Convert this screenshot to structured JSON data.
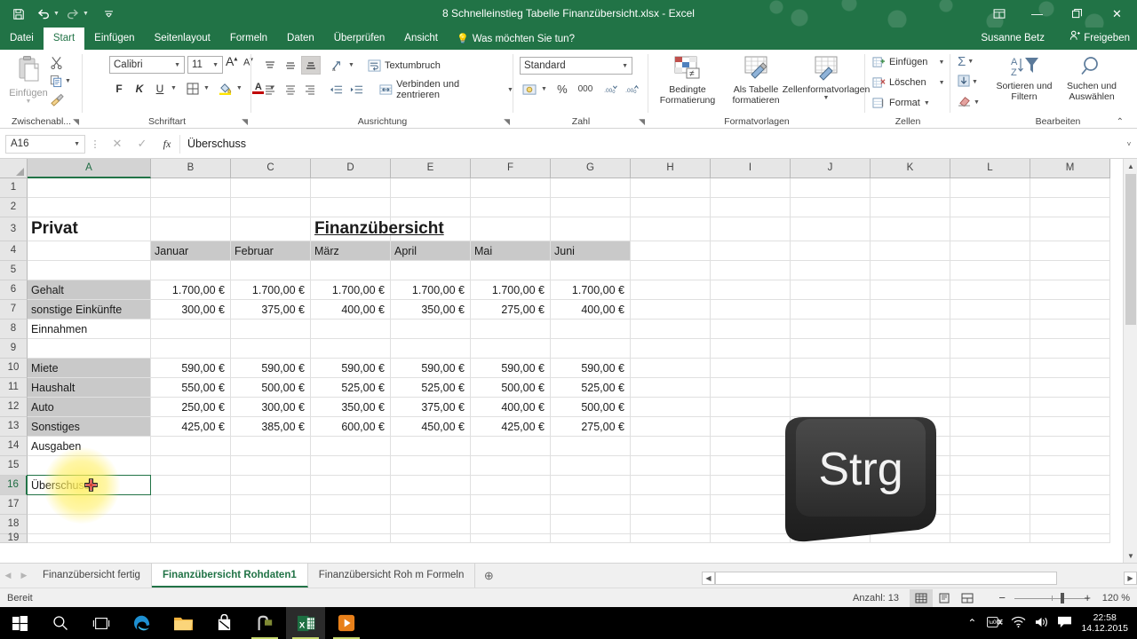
{
  "titlebar": {
    "document_title": "8 Schnelleinstieg Tabelle Finanzübersicht.xlsx - Excel",
    "qat": [
      {
        "name": "save",
        "glyph": "ὋE"
      },
      {
        "name": "undo",
        "glyph": "↶"
      },
      {
        "name": "redo",
        "glyph": "↷"
      },
      {
        "name": "customize",
        "glyph": "▾"
      }
    ],
    "ribbon_display_options": "⬚",
    "minimize": "—",
    "restore": "❐",
    "close": "✕"
  },
  "ribbon_tabs": [
    {
      "label": "Datei",
      "active": false
    },
    {
      "label": "Start",
      "active": true
    },
    {
      "label": "Einfügen",
      "active": false
    },
    {
      "label": "Seitenlayout",
      "active": false
    },
    {
      "label": "Formeln",
      "active": false
    },
    {
      "label": "Daten",
      "active": false
    },
    {
      "label": "Überprüfen",
      "active": false
    },
    {
      "label": "Ansicht",
      "active": false
    }
  ],
  "tell_me": "Was möchten Sie tun?",
  "account_name": "Susanne Betz",
  "share_label": "Freigeben",
  "ribbon": {
    "clipboard": {
      "group_label": "Zwischenabl...",
      "paste_label": "Einfügen",
      "cut": "Ausschneiden",
      "copy": "Kopieren",
      "format_painter": "Format übertragen"
    },
    "font": {
      "group_label": "Schriftart",
      "font_name": "Calibri",
      "font_size": "11",
      "grow_font": "A",
      "shrink_font": "A",
      "bold": "F",
      "italic": "K",
      "underline": "U",
      "borders": "Rahmen",
      "fill_color": "Füllfarbe",
      "font_color": "Schriftfarbe"
    },
    "alignment": {
      "group_label": "Ausrichtung",
      "wrap_text": "Textumbruch",
      "merge_center": "Verbinden und zentrieren"
    },
    "number": {
      "group_label": "Zahl",
      "format": "Standard",
      "percent": "%",
      "thousands": "000",
      "increase_decimal": "·⁰00",
      "decrease_decimal": "→00"
    },
    "styles": {
      "group_label": "Formatvorlagen",
      "conditional_line1": "Bedingte",
      "conditional_line2": "Formatierung",
      "astable_line1": "Als Tabelle",
      "astable_line2": "formatieren",
      "cellstyles": "Zellenformatvorlagen"
    },
    "cells": {
      "group_label": "Zellen",
      "insert": "Einfügen",
      "delete": "Löschen",
      "format": "Format"
    },
    "editing": {
      "group_label": "Bearbeiten",
      "autosum": "Σ",
      "fill": "↓",
      "clear": "⌫",
      "sort_line1": "Sortieren und",
      "sort_line2": "Filtern",
      "find_line1": "Suchen und",
      "find_line2": "Auswählen"
    },
    "collapse_ribbon": "⌃"
  },
  "formula_bar": {
    "name_box": "A16",
    "cancel": "✕",
    "enter": "✓",
    "insert_function": "fx",
    "content": "Überschuss",
    "expand": "˅"
  },
  "grid": {
    "columns": [
      "A",
      "B",
      "C",
      "D",
      "E",
      "F",
      "G",
      "H",
      "I",
      "J",
      "K",
      "L",
      "M"
    ],
    "rows": [
      "1",
      "2",
      "3",
      "4",
      "5",
      "6",
      "7",
      "8",
      "9",
      "10",
      "11",
      "12",
      "13",
      "14",
      "15",
      "16",
      "17",
      "18",
      "19"
    ],
    "selected_cell": "A16",
    "cells": [
      {
        "row": 3,
        "col": "A",
        "value": "Privat",
        "style": "title"
      },
      {
        "row": 3,
        "col": "D",
        "value": "Finanzübersicht",
        "style": "bigtitle"
      },
      {
        "row": 4,
        "col": "B",
        "value": "Januar",
        "style": "shade"
      },
      {
        "row": 4,
        "col": "C",
        "value": "Februar",
        "style": "shade"
      },
      {
        "row": 4,
        "col": "D",
        "value": "März",
        "style": "shade"
      },
      {
        "row": 4,
        "col": "E",
        "value": "April",
        "style": "shade"
      },
      {
        "row": 4,
        "col": "F",
        "value": "Mai",
        "style": "shade"
      },
      {
        "row": 4,
        "col": "G",
        "value": "Juni",
        "style": "shade"
      },
      {
        "row": 6,
        "col": "A",
        "value": "Gehalt",
        "style": "shade"
      },
      {
        "row": 6,
        "col": "B",
        "value": "1.700,00 €",
        "style": "num"
      },
      {
        "row": 6,
        "col": "C",
        "value": "1.700,00 €",
        "style": "num"
      },
      {
        "row": 6,
        "col": "D",
        "value": "1.700,00 €",
        "style": "num"
      },
      {
        "row": 6,
        "col": "E",
        "value": "1.700,00 €",
        "style": "num"
      },
      {
        "row": 6,
        "col": "F",
        "value": "1.700,00 €",
        "style": "num"
      },
      {
        "row": 6,
        "col": "G",
        "value": "1.700,00 €",
        "style": "num"
      },
      {
        "row": 7,
        "col": "A",
        "value": "sonstige Einkünfte",
        "style": "shade"
      },
      {
        "row": 7,
        "col": "B",
        "value": "300,00 €",
        "style": "num"
      },
      {
        "row": 7,
        "col": "C",
        "value": "375,00 €",
        "style": "num"
      },
      {
        "row": 7,
        "col": "D",
        "value": "400,00 €",
        "style": "num"
      },
      {
        "row": 7,
        "col": "E",
        "value": "350,00 €",
        "style": "num"
      },
      {
        "row": 7,
        "col": "F",
        "value": "275,00 €",
        "style": "num"
      },
      {
        "row": 7,
        "col": "G",
        "value": "400,00 €",
        "style": "num"
      },
      {
        "row": 8,
        "col": "A",
        "value": "Einnahmen",
        "style": ""
      },
      {
        "row": 10,
        "col": "A",
        "value": "Miete",
        "style": "shade"
      },
      {
        "row": 10,
        "col": "B",
        "value": "590,00 €",
        "style": "num"
      },
      {
        "row": 10,
        "col": "C",
        "value": "590,00 €",
        "style": "num"
      },
      {
        "row": 10,
        "col": "D",
        "value": "590,00 €",
        "style": "num"
      },
      {
        "row": 10,
        "col": "E",
        "value": "590,00 €",
        "style": "num"
      },
      {
        "row": 10,
        "col": "F",
        "value": "590,00 €",
        "style": "num"
      },
      {
        "row": 10,
        "col": "G",
        "value": "590,00 €",
        "style": "num"
      },
      {
        "row": 11,
        "col": "A",
        "value": "Haushalt",
        "style": "shade"
      },
      {
        "row": 11,
        "col": "B",
        "value": "550,00 €",
        "style": "num"
      },
      {
        "row": 11,
        "col": "C",
        "value": "500,00 €",
        "style": "num"
      },
      {
        "row": 11,
        "col": "D",
        "value": "525,00 €",
        "style": "num"
      },
      {
        "row": 11,
        "col": "E",
        "value": "525,00 €",
        "style": "num"
      },
      {
        "row": 11,
        "col": "F",
        "value": "500,00 €",
        "style": "num"
      },
      {
        "row": 11,
        "col": "G",
        "value": "525,00 €",
        "style": "num"
      },
      {
        "row": 12,
        "col": "A",
        "value": "Auto",
        "style": "shade"
      },
      {
        "row": 12,
        "col": "B",
        "value": "250,00 €",
        "style": "num"
      },
      {
        "row": 12,
        "col": "C",
        "value": "300,00 €",
        "style": "num"
      },
      {
        "row": 12,
        "col": "D",
        "value": "350,00 €",
        "style": "num"
      },
      {
        "row": 12,
        "col": "E",
        "value": "375,00 €",
        "style": "num"
      },
      {
        "row": 12,
        "col": "F",
        "value": "400,00 €",
        "style": "num"
      },
      {
        "row": 12,
        "col": "G",
        "value": "500,00 €",
        "style": "num"
      },
      {
        "row": 13,
        "col": "A",
        "value": "Sonstiges",
        "style": "shade"
      },
      {
        "row": 13,
        "col": "B",
        "value": "425,00 €",
        "style": "num"
      },
      {
        "row": 13,
        "col": "C",
        "value": "385,00 €",
        "style": "num"
      },
      {
        "row": 13,
        "col": "D",
        "value": "600,00 €",
        "style": "num"
      },
      {
        "row": 13,
        "col": "E",
        "value": "450,00 €",
        "style": "num"
      },
      {
        "row": 13,
        "col": "F",
        "value": "425,00 €",
        "style": "num"
      },
      {
        "row": 13,
        "col": "G",
        "value": "275,00 €",
        "style": "num"
      },
      {
        "row": 14,
        "col": "A",
        "value": "Ausgaben",
        "style": ""
      },
      {
        "row": 16,
        "col": "A",
        "value": "Überschuss",
        "style": ""
      }
    ]
  },
  "overlay": {
    "key_label": "Strg"
  },
  "sheet_tabs": [
    {
      "label": "Finanzübersicht fertig",
      "active": false
    },
    {
      "label": "Finanzübersicht Rohdaten1",
      "active": true
    },
    {
      "label": "Finanzübersicht Roh m Formeln",
      "active": false
    }
  ],
  "add_sheet": "⊕",
  "status_bar": {
    "mode": "Bereit",
    "count": "Anzahl: 13",
    "view_normal": "▦",
    "view_pagelayout": "▤",
    "view_pagebreak": "▥",
    "zoom_out": "−",
    "zoom_in": "+",
    "zoom_level": "120 %"
  },
  "taskbar": {
    "items": [
      {
        "name": "start-button",
        "label": "Start"
      },
      {
        "name": "search",
        "label": "Suchen"
      },
      {
        "name": "task-view",
        "label": "Taskansicht"
      },
      {
        "name": "edge",
        "label": "Microsoft Edge"
      },
      {
        "name": "file-explorer",
        "label": "Explorer"
      },
      {
        "name": "store",
        "label": "Store"
      },
      {
        "name": "camtasia",
        "label": "Camtasia"
      },
      {
        "name": "excel",
        "label": "Excel"
      },
      {
        "name": "media-player",
        "label": "Media Player"
      }
    ],
    "tray": {
      "show_hidden": "⌃",
      "keyboard": "⌨",
      "network": "὏6",
      "volume": "ὐA",
      "action_center": "὚5",
      "time": "22:58",
      "date": "14.12.2015"
    }
  },
  "colors": {
    "excel_green": "#217346",
    "shade_gray": "#c9c9c9",
    "selection": "#217346"
  }
}
